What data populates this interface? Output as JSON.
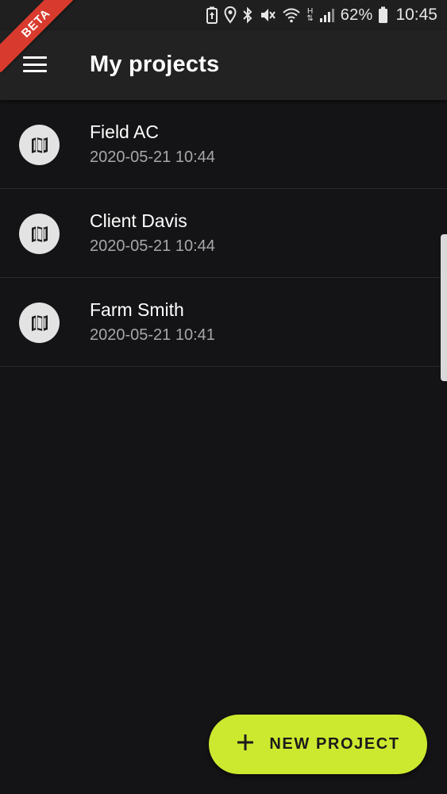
{
  "status_bar": {
    "battery_percent": "62%",
    "time": "10:45",
    "network_label": "H",
    "icons": [
      "battery-saver-icon",
      "location-icon",
      "bluetooth-icon",
      "mute-icon",
      "wifi-icon",
      "network-type-icon",
      "signal-icon",
      "battery-icon"
    ]
  },
  "app_bar": {
    "title": "My projects",
    "menu_icon": "menu-icon"
  },
  "beta_badge": "BETA",
  "projects": [
    {
      "name": "Field AC",
      "date": "2020-05-21 10:44",
      "icon": "map-icon"
    },
    {
      "name": "Client Davis",
      "date": "2020-05-21 10:44",
      "icon": "map-icon"
    },
    {
      "name": "Farm Smith",
      "date": "2020-05-21 10:41",
      "icon": "map-icon"
    }
  ],
  "fab": {
    "label": "NEW PROJECT",
    "icon": "plus-icon"
  },
  "colors": {
    "background": "#141315",
    "app_bar": "#222223",
    "accent": "#cde92f",
    "beta_ribbon": "#d83b2e",
    "secondary_text": "#a7a7a9"
  }
}
